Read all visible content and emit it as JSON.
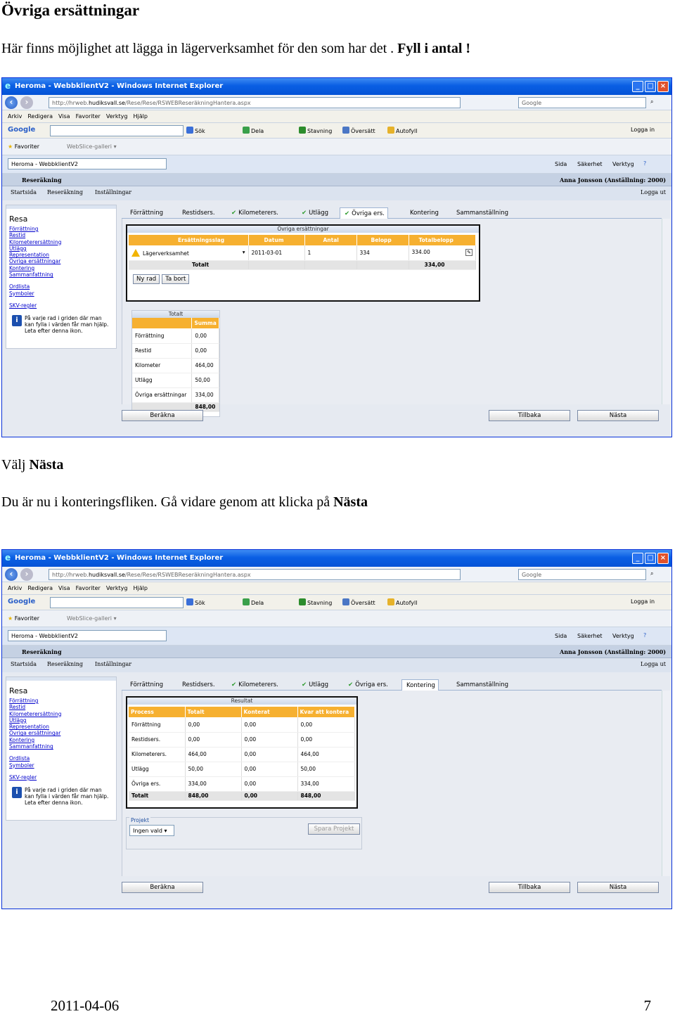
{
  "doc": {
    "heading": "Övriga ersättningar",
    "intro": "Här finns möjlighet att lägga in lägerverksamhet för den som har det .",
    "intro_bold": "Fyll i antal !",
    "step1_pre": "Välj",
    "step1_bold": "Nästa",
    "step2_pre": "Du är nu i konteringsfliken. Gå vidare genom att klicka på",
    "step2_bold": "Nästa",
    "footer_date": "2011-04-06",
    "page_number": "7"
  },
  "browser": {
    "title": "Heroma - WebbklientV2 - Windows Internet Explorer",
    "url1_pre": "http://hrweb.",
    "url1_dom": "hudiksvall.se",
    "url1_post": "/Rese/Rese/RSWEBReseräkningHantera.aspx",
    "url2_pre": "http://hrweb.",
    "url2_dom": "hudiksvall.se",
    "url2_post": "/Rese/Rese/RSWEBReseräkningHantera.aspx",
    "search_placeholder": "Google",
    "menu": [
      "Arkiv",
      "Redigera",
      "Visa",
      "Favoriter",
      "Verktyg",
      "Hjälp"
    ],
    "google_bar": {
      "logo": "Google",
      "sok": "Sök",
      "dela": "Dela",
      "stavning": "Stavning",
      "oversatt": "Översätt",
      "autofyll": "Autofyll",
      "logga_in": "Logga in"
    },
    "fav": {
      "favoriter": "Favoriter",
      "webslice": "WebSlice-galleri"
    },
    "tab_title": "Heroma - WebbklientV2",
    "cmd": {
      "sida": "Sida",
      "sakerhet": "Säkerhet",
      "verktyg": "Verktyg"
    }
  },
  "app": {
    "section": "Reseräkning",
    "user": "Anna Jonsson (Anställning: 2000)",
    "nav": [
      "Startsida",
      "Reseräkning",
      "Inställningar"
    ],
    "logout": "Logga ut",
    "left": {
      "title": "Resa",
      "links": [
        "Förrättning",
        "Restid",
        "Kilometerersättning",
        "Utlägg",
        "Representation",
        "Övriga ersättningar",
        "Kontering",
        "Sammanfattning"
      ],
      "links2": [
        "Ordlista",
        "Symboler"
      ],
      "links3": [
        "SKV-regler"
      ],
      "info": "På varje rad i griden där man kan fylla i värden får man hjälp. Leta efter denna ikon."
    },
    "tabs": [
      "Förrättning",
      "Restidsers.",
      "Kilometerers.",
      "Utlägg",
      "Övriga ers.",
      "Kontering",
      "Sammanställning"
    ],
    "buttons": {
      "berakna": "Beräkna",
      "tillbaka": "Tillbaka",
      "nasta": "Nästa"
    }
  },
  "s1": {
    "grid_title": "Övriga ersättningar",
    "headers": [
      "Ersättningsslag",
      "Datum",
      "Antal",
      "Belopp",
      "Totalbelopp"
    ],
    "row": {
      "slag": "Lägerverksamhet",
      "datum": "2011-03-01",
      "antal": "1",
      "belopp": "334",
      "totalbelopp": "334.00"
    },
    "total_label": "Totalt",
    "total_value": "334,00",
    "ny_rad": "Ny rad",
    "ta_bort": "Ta bort",
    "summary_title": "Totalt",
    "summary_header": "Summa",
    "summary": [
      {
        "label": "Förrättning",
        "value": "0,00"
      },
      {
        "label": "Restid",
        "value": "0,00"
      },
      {
        "label": "Kilometer",
        "value": "464,00"
      },
      {
        "label": "Utlägg",
        "value": "50,00"
      },
      {
        "label": "Övriga ersättningar",
        "value": "334,00"
      }
    ],
    "summary_total": "848,00"
  },
  "s2": {
    "grid_title": "Resultat",
    "headers": [
      "Process",
      "Totalt",
      "Konterat",
      "Kvar att kontera"
    ],
    "rows": [
      [
        "Förrättning",
        "0,00",
        "0,00",
        "0,00"
      ],
      [
        "Restidsers.",
        "0,00",
        "0,00",
        "0,00"
      ],
      [
        "Kilometerers.",
        "464,00",
        "0,00",
        "464,00"
      ],
      [
        "Utlägg",
        "50,00",
        "0,00",
        "50,00"
      ],
      [
        "Övriga ers.",
        "334,00",
        "0,00",
        "334,00"
      ]
    ],
    "total": [
      "Totalt",
      "848,00",
      "0,00",
      "848,00"
    ],
    "projekt_label": "Projekt",
    "projekt_value": "Ingen vald",
    "spara": "Spara Projekt"
  }
}
